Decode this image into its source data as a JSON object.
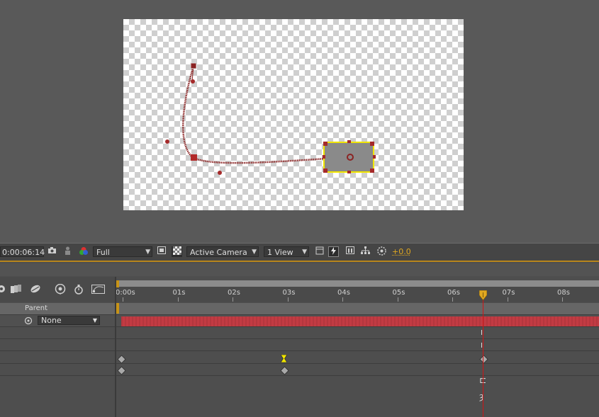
{
  "toolbar": {
    "timecode": "0:00:06:14",
    "resolution": "Full",
    "camera": "Active Camera",
    "view_layout": "1 View",
    "exposure": "+0.0"
  },
  "timeline": {
    "ruler_labels": [
      "0:00s",
      "01s",
      "02s",
      "03s",
      "04s",
      "05s",
      "06s",
      "07s",
      "08s"
    ],
    "parent_header": "Parent",
    "parent_value": "None"
  },
  "colors": {
    "motion_path": "#8b2323",
    "layer_bar": "#c23b43",
    "playhead": "#d01616",
    "selection": "#f2e600",
    "accent": "#e0a820"
  }
}
